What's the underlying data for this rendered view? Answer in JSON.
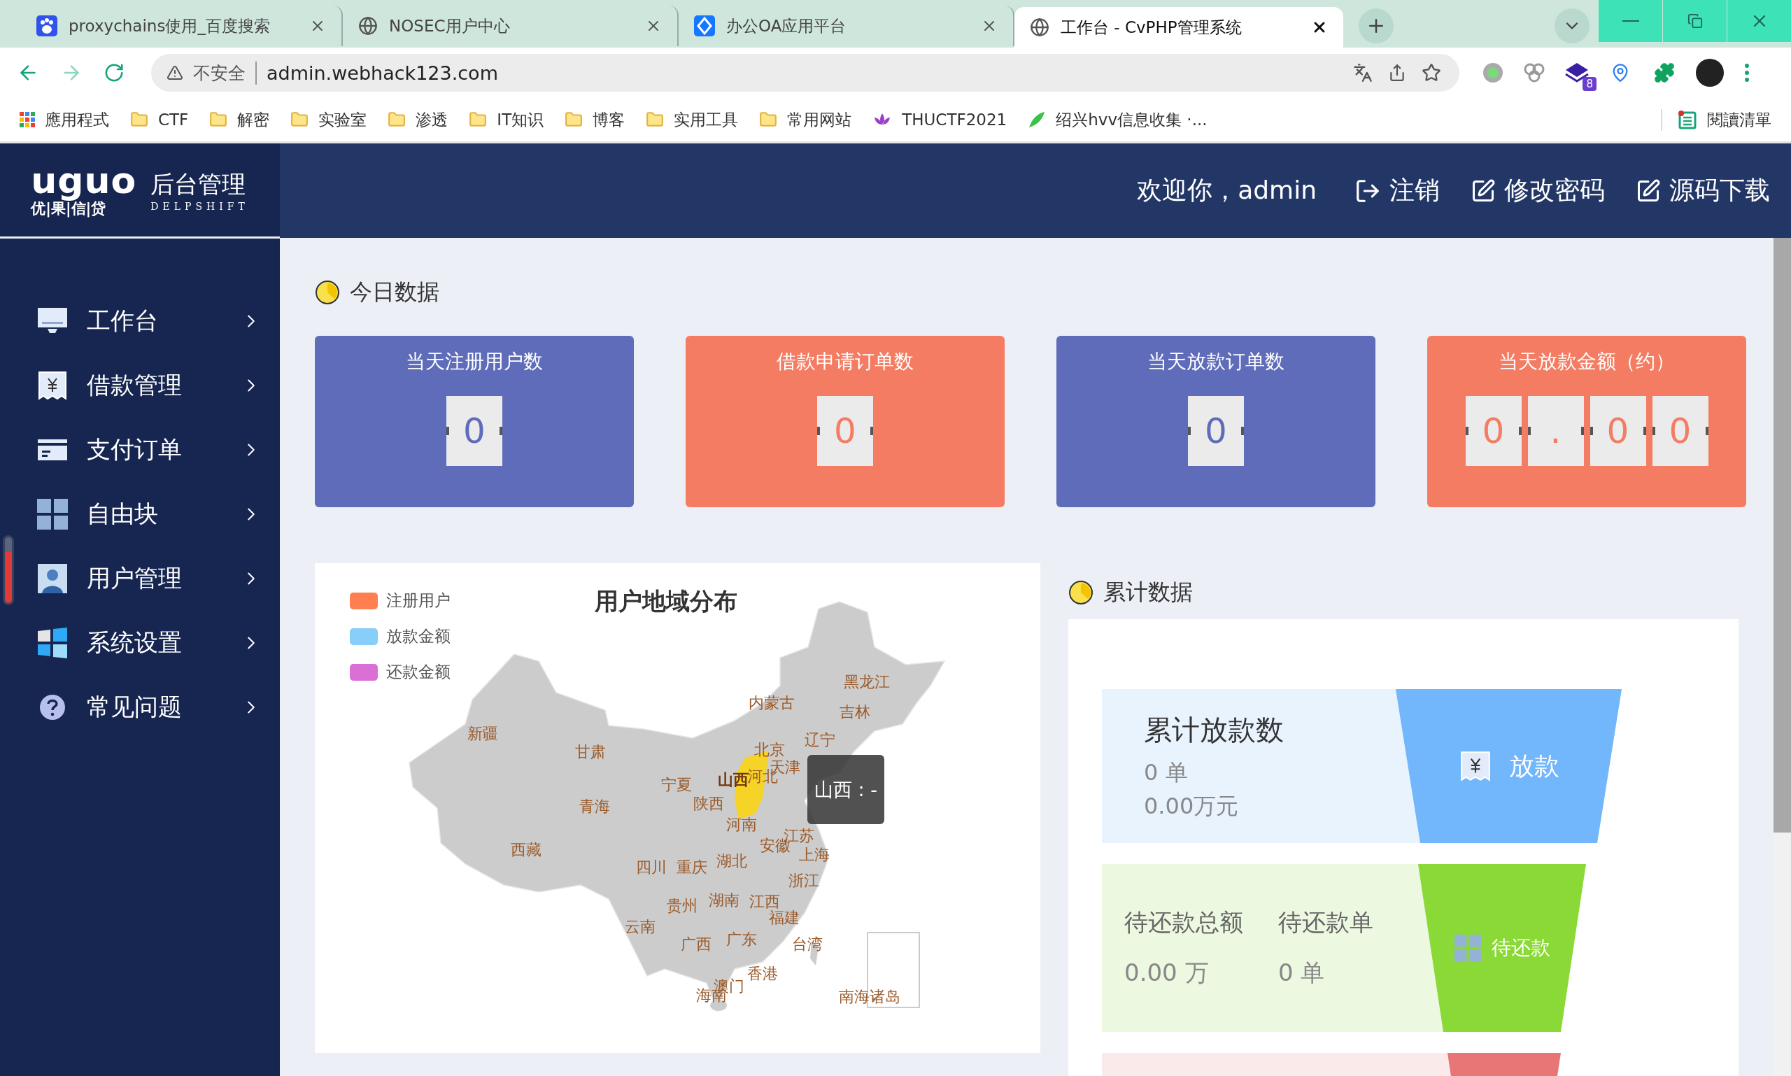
{
  "browser": {
    "tabs": [
      {
        "title": "proxychains使用_百度搜索",
        "kind": "paw",
        "selected": false
      },
      {
        "title": "NOSEC用户中心",
        "kind": "globe",
        "selected": false
      },
      {
        "title": "办公OA应用平台",
        "kind": "diamond",
        "selected": false
      },
      {
        "title": "工作台 - CvPHP管理系统",
        "kind": "globe",
        "selected": true
      }
    ],
    "security_label": "不安全",
    "url": "admin.webhack123.com",
    "extension_badge": "8",
    "bookmarks": [
      {
        "label": "應用程式",
        "kind": "apps"
      },
      {
        "label": "CTF",
        "kind": "folder"
      },
      {
        "label": "解密",
        "kind": "folder"
      },
      {
        "label": "实验室",
        "kind": "folder"
      },
      {
        "label": "渗透",
        "kind": "folder"
      },
      {
        "label": "IT知识",
        "kind": "folder"
      },
      {
        "label": "博客",
        "kind": "folder"
      },
      {
        "label": "实用工具",
        "kind": "folder"
      },
      {
        "label": "常用网站",
        "kind": "folder"
      },
      {
        "label": "THUCTF2021",
        "kind": "lotus"
      },
      {
        "label": "绍兴hvv信息收集 ·...",
        "kind": "bird"
      }
    ],
    "reading_list": "閱讀清單"
  },
  "logo": {
    "mark": "uguo",
    "sub": "优|果|信|贷",
    "title": "后台管理",
    "tagline": "DELPSHIFT"
  },
  "header": {
    "welcome": "欢迎你，admin",
    "actions": [
      {
        "label": "注销",
        "kind": "logout"
      },
      {
        "label": "修改密码",
        "kind": "edit"
      },
      {
        "label": "源码下载",
        "kind": "edit"
      }
    ]
  },
  "sidebar": {
    "items": [
      {
        "label": "工作台",
        "kind": "monitor"
      },
      {
        "label": "借款管理",
        "kind": "receipt"
      },
      {
        "label": "支付订单",
        "kind": "card"
      },
      {
        "label": "自由块",
        "kind": "grid"
      },
      {
        "label": "用户管理",
        "kind": "user"
      },
      {
        "label": "系统设置",
        "kind": "windows"
      },
      {
        "label": "常见问题",
        "kind": "help"
      }
    ]
  },
  "today": {
    "title": "今日数据",
    "cards": [
      {
        "title": "当天注册用户数",
        "color": "#5f6cba",
        "digits": [
          "0"
        ]
      },
      {
        "title": "借款申请订单数",
        "color": "#f47c62",
        "digits": [
          "0"
        ]
      },
      {
        "title": "当天放款订单数",
        "color": "#5f6cba",
        "digits": [
          "0"
        ]
      },
      {
        "title": "当天放款金额（约）",
        "color": "#f47c62",
        "digits": [
          "0",
          ".",
          "0",
          "0"
        ]
      }
    ]
  },
  "map": {
    "title": "用户地域分布",
    "legend": [
      {
        "label": "注册用户",
        "color": "#ff7f50"
      },
      {
        "label": "放款金额",
        "color": "#87cefa"
      },
      {
        "label": "还款金额",
        "color": "#da70d6"
      }
    ],
    "regions": [
      {
        "name": "新疆",
        "selected": false
      },
      {
        "name": "甘肃",
        "selected": false
      },
      {
        "name": "青海",
        "selected": false
      },
      {
        "name": "西藏",
        "selected": false
      },
      {
        "name": "内蒙古",
        "selected": false
      },
      {
        "name": "黑龙江",
        "selected": false
      },
      {
        "name": "吉林",
        "selected": false
      },
      {
        "name": "辽宁",
        "selected": false
      },
      {
        "name": "北京",
        "selected": false
      },
      {
        "name": "天津",
        "selected": false
      },
      {
        "name": "宁夏",
        "selected": false
      },
      {
        "name": "山西",
        "selected": true
      },
      {
        "name": "河北",
        "selected": false
      },
      {
        "name": "陕西",
        "selected": false
      },
      {
        "name": "河南",
        "selected": false
      },
      {
        "name": "江苏",
        "selected": false
      },
      {
        "name": "安徽",
        "selected": false
      },
      {
        "name": "湖北",
        "selected": false
      },
      {
        "name": "上海",
        "selected": false
      },
      {
        "name": "四川",
        "selected": false
      },
      {
        "name": "重庆",
        "selected": false
      },
      {
        "name": "浙江",
        "selected": false
      },
      {
        "name": "贵州",
        "selected": false
      },
      {
        "name": "湖南",
        "selected": false
      },
      {
        "name": "江西",
        "selected": false
      },
      {
        "name": "福建",
        "selected": false
      },
      {
        "name": "云南",
        "selected": false
      },
      {
        "name": "广西",
        "selected": false
      },
      {
        "name": "广东",
        "selected": false
      },
      {
        "name": "台湾",
        "selected": false
      },
      {
        "name": "香港",
        "selected": false
      },
      {
        "name": "澳门",
        "selected": false
      },
      {
        "name": "海南",
        "selected": false
      },
      {
        "name": "南海诸岛",
        "selected": false
      }
    ],
    "tooltip": "山西 : -"
  },
  "cumulative": {
    "title": "累计数据",
    "rows": [
      {
        "kind": "single",
        "color": "#72b6fb",
        "title": "累计放款数",
        "lines": [
          "0 单",
          "0.00万元"
        ],
        "tag": "放款"
      },
      {
        "kind": "columns",
        "color": "#8bd936",
        "columns": [
          {
            "label": "待还款总额",
            "value": "0.00 万"
          },
          {
            "label": "待还款单",
            "value": "0 单"
          }
        ],
        "tag": "待还款"
      },
      {
        "kind": "empty",
        "color": "#e87676"
      }
    ]
  }
}
